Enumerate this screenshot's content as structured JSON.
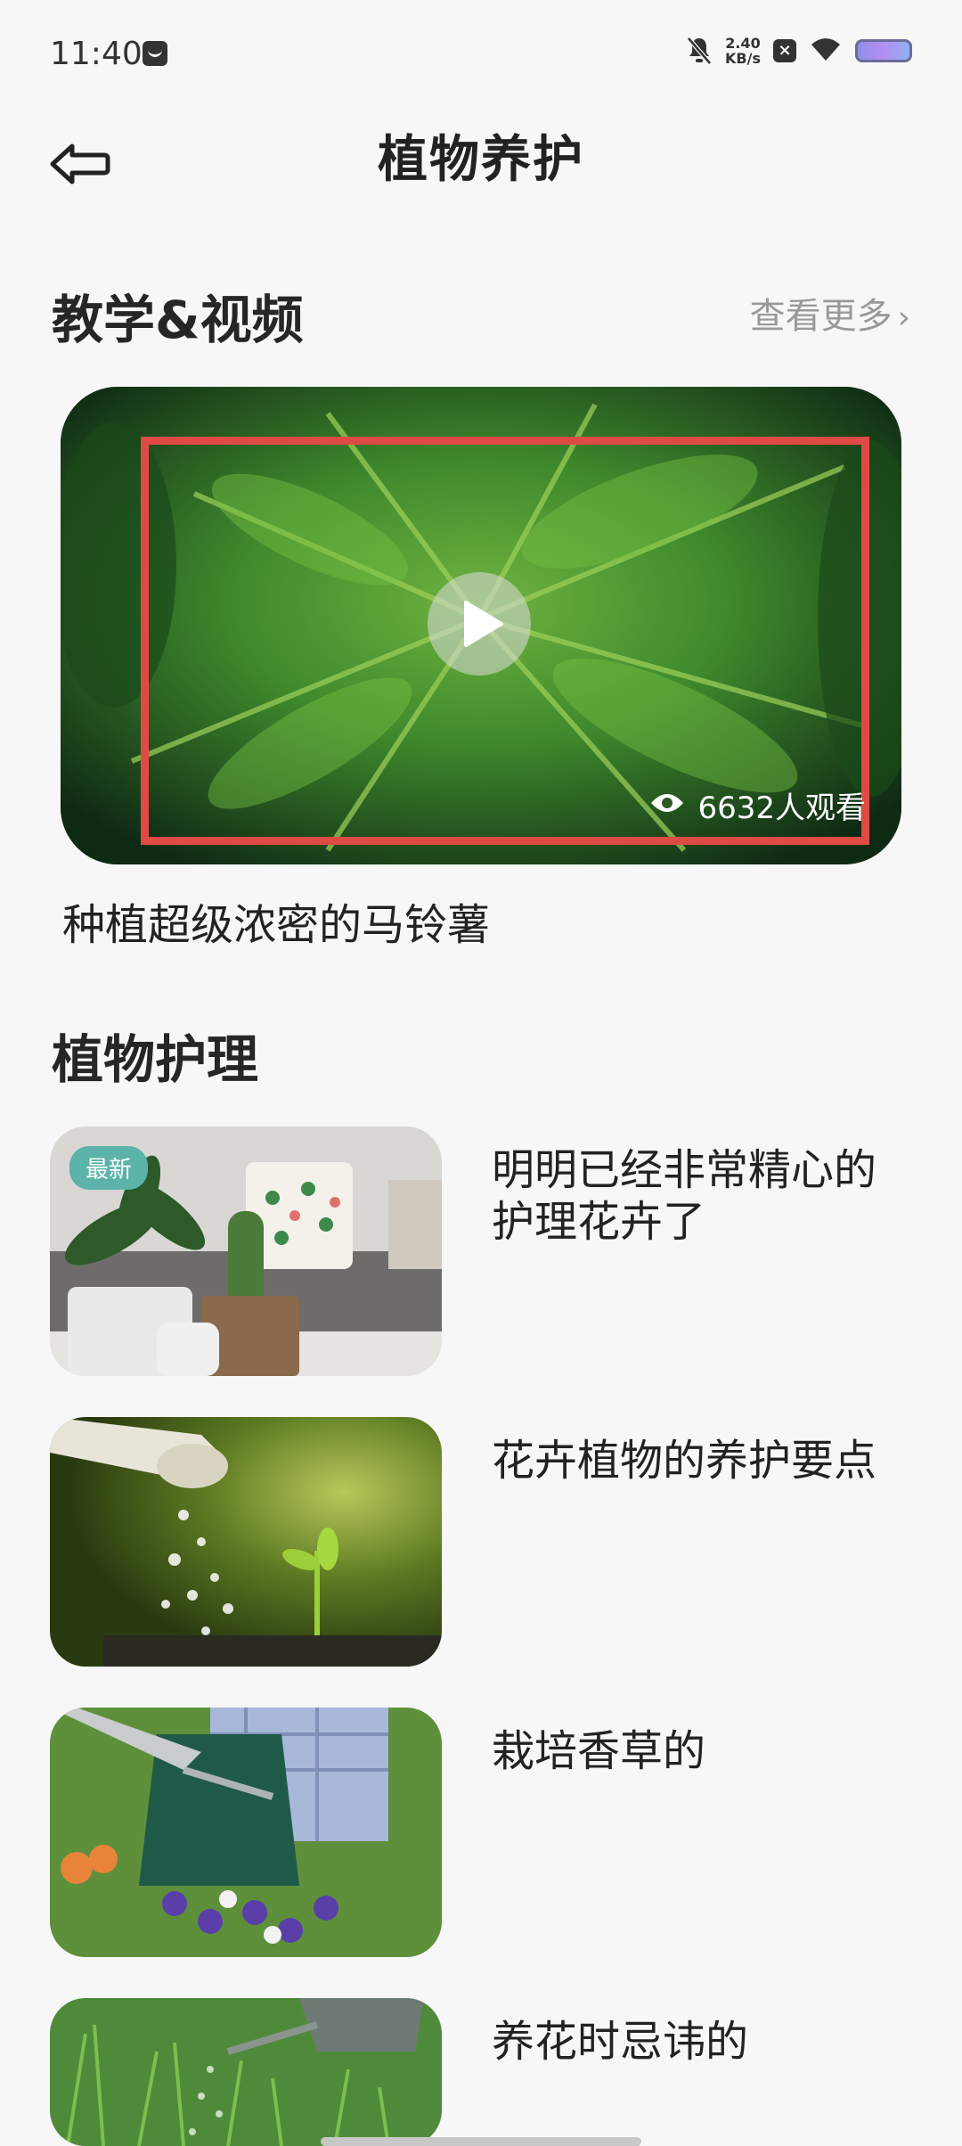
{
  "status_bar": {
    "time": "11:40",
    "net_speed_value": "2.40",
    "net_speed_unit": "KB/s",
    "icons": [
      "message-icon",
      "bell-off-icon",
      "close-badge-icon",
      "wifi-icon",
      "battery-icon"
    ]
  },
  "header": {
    "title": "植物养护",
    "back_icon": "back-arrow-icon"
  },
  "video_section": {
    "title": "教学&视频",
    "see_more_label": "查看更多",
    "video": {
      "view_count": "6632人观看",
      "caption": "种植超级浓密的马铃薯"
    }
  },
  "care_section": {
    "title": "植物护理",
    "items": [
      {
        "title": "明明已经非常精心的护理花卉了",
        "badge": "最新"
      },
      {
        "title": "花卉植物的养护要点"
      },
      {
        "title": "栽培香草的"
      },
      {
        "title": "养花时忌讳的"
      }
    ]
  },
  "colors": {
    "highlight": "#e04a45",
    "badge": "#5cb3a9",
    "background": "#f7f7f7"
  }
}
